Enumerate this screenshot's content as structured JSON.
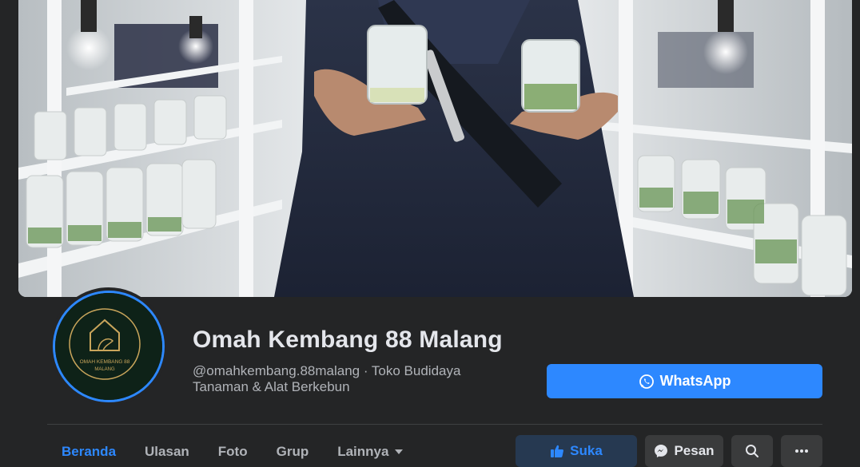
{
  "page": {
    "name": "Omah Kembang 88 Malang",
    "handle_category_line1": "@omahkembang.88malang · Toko Budidaya",
    "handle_category_line2": "Tanaman & Alat Berkebun"
  },
  "avatar": {
    "logo_text_line1": "OMAH KEMBANG 88",
    "logo_text_line2": "MALANG"
  },
  "cta": {
    "whatsapp_label": "WhatsApp",
    "whatsapp_color": "#2d88ff"
  },
  "tabs": [
    {
      "label": "Beranda",
      "active": true
    },
    {
      "label": "Ulasan",
      "active": false
    },
    {
      "label": "Foto",
      "active": false
    },
    {
      "label": "Grup",
      "active": false
    },
    {
      "label": "Lainnya",
      "active": false
    }
  ],
  "actions": {
    "like_label": "Suka",
    "message_label": "Pesan",
    "search_icon": "search-icon",
    "more_icon": "more-icon"
  },
  "colors": {
    "accent": "#2d88ff",
    "background": "#242526",
    "text_primary": "#e4e6eb",
    "text_secondary": "#b0b3b8"
  }
}
